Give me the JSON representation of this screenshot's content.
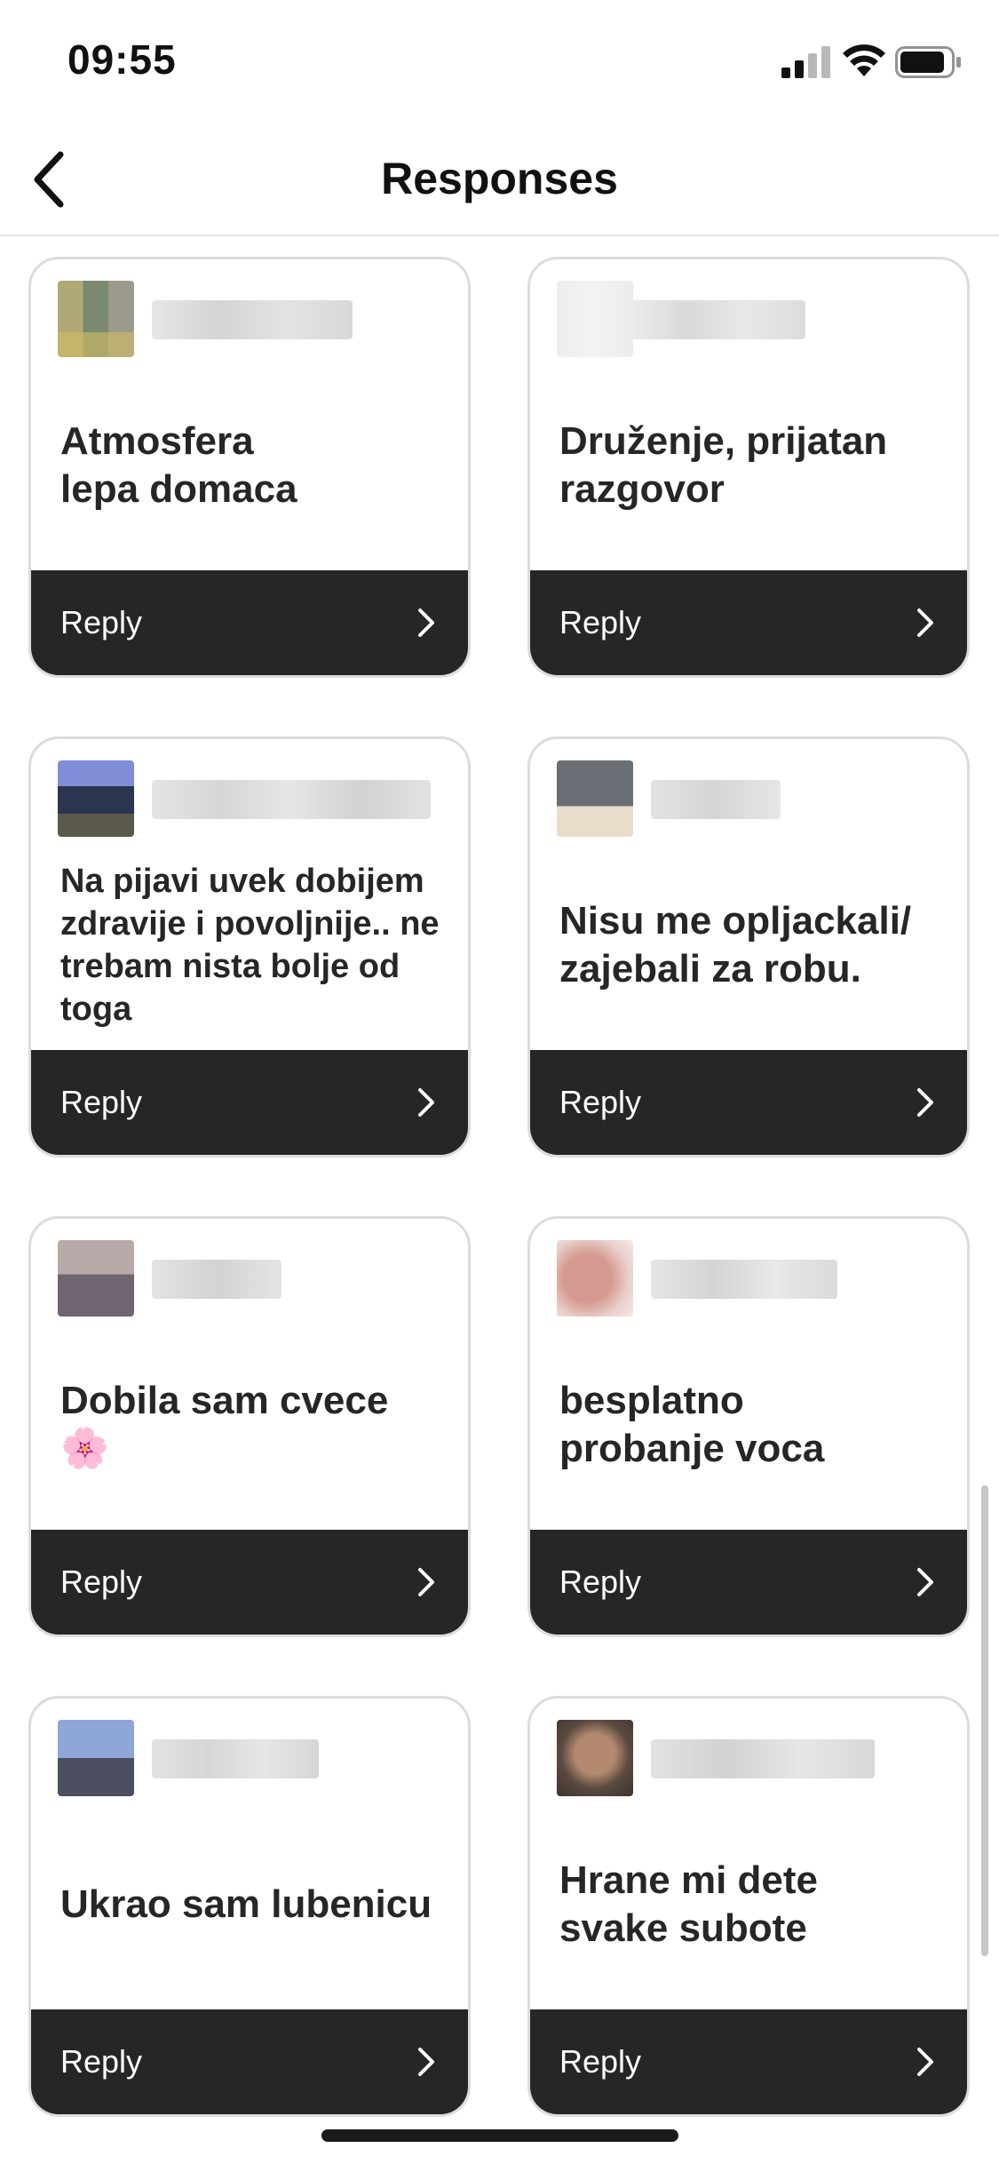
{
  "status": {
    "time": "09:55"
  },
  "header": {
    "title": "Responses"
  },
  "responses": [
    {
      "text": "Atmosfera\nlepa domaca",
      "reply_label": "Reply"
    },
    {
      "text": "Druženje, prijatan\nrazgovor",
      "reply_label": "Reply"
    },
    {
      "text": "Na pijavi uvek dobijem zdravije i povoljnije.. ne trebam nista bolje od toga",
      "reply_label": "Reply"
    },
    {
      "text": "Nisu me opljackali/\nzajebali za robu.",
      "reply_label": "Reply"
    },
    {
      "text": "Dobila sam cvece\n🌸",
      "reply_label": "Reply"
    },
    {
      "text": "besplatno\nprobanje voca",
      "reply_label": "Reply"
    },
    {
      "text": "Ukrao sam lubenicu",
      "reply_label": "Reply"
    },
    {
      "text": "Hrane mi dete\nsvake subote",
      "reply_label": "Reply"
    }
  ],
  "colors": {
    "reply_bar": "#262626",
    "card_border": "#dcdcdc",
    "text": "#262626"
  }
}
